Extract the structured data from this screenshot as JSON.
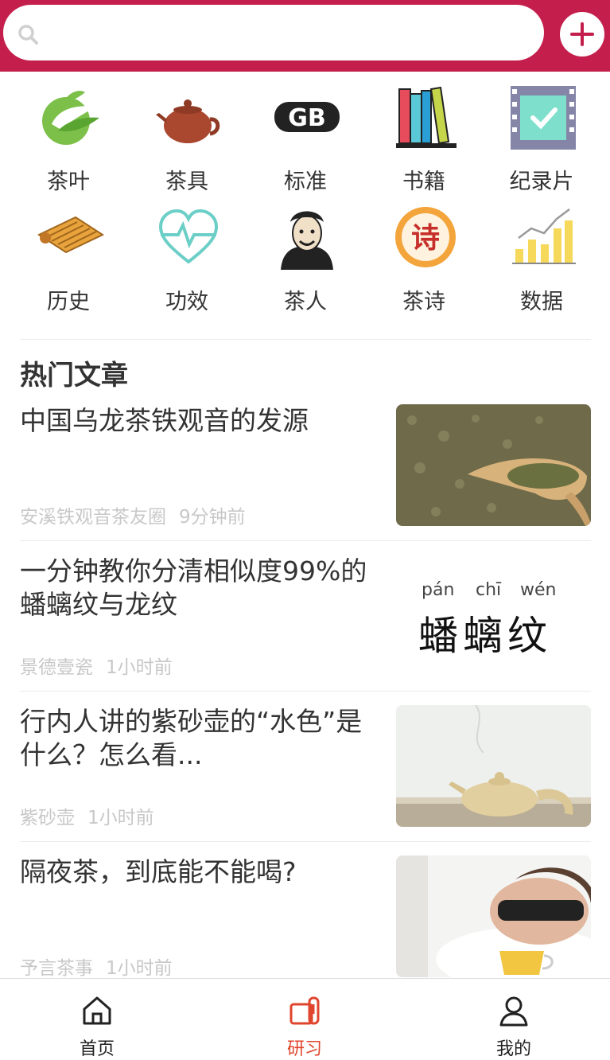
{
  "search": {
    "placeholder": ""
  },
  "categories": [
    {
      "label": "茶叶",
      "icon": "tea-leaf-icon"
    },
    {
      "label": "茶具",
      "icon": "teapot-icon"
    },
    {
      "label": "标准",
      "icon": "gb-standard-icon"
    },
    {
      "label": "书籍",
      "icon": "books-icon"
    },
    {
      "label": "纪录片",
      "icon": "film-icon"
    },
    {
      "label": "历史",
      "icon": "scroll-icon"
    },
    {
      "label": "功效",
      "icon": "heart-pulse-icon"
    },
    {
      "label": "茶人",
      "icon": "portrait-icon"
    },
    {
      "label": "茶诗",
      "icon": "poem-seal-icon"
    },
    {
      "label": "数据",
      "icon": "bar-chart-icon"
    }
  ],
  "section": {
    "title": "热门文章"
  },
  "articles": [
    {
      "title": "中国乌龙茶铁观音的发源",
      "source": "安溪铁观音茶友圈",
      "time": "9分钟前",
      "thumb": "tea-leaves-scoop-photo"
    },
    {
      "title": "一分钟教你分清相似度99%的蟠螭纹与龙纹",
      "source": "景德壹瓷",
      "time": "1小时前",
      "thumb": "panchiwen-calligraphy-image",
      "thumb_text": {
        "pinyin1": "pán",
        "pinyin2": "chī",
        "pinyin3": "wén",
        "chars": "蟠螭纹"
      }
    },
    {
      "title": "行内人讲的紫砂壶的“水色”是什么？怎么看...",
      "source": "紫砂壶",
      "time": "1小时前",
      "thumb": "zisha-teapot-photo"
    },
    {
      "title": "隔夜茶，到底能不能喝?",
      "source": "予言茶事",
      "time": "1小时前",
      "thumb": "sleeping-man-tea-photo"
    }
  ],
  "tabbar": {
    "tabs": [
      {
        "label": "首页",
        "icon": "home-icon",
        "active": false
      },
      {
        "label": "研习",
        "icon": "study-icon",
        "active": true
      },
      {
        "label": "我的",
        "icon": "user-icon",
        "active": false
      }
    ],
    "active_color": "#e0452d"
  },
  "colors": {
    "brand": "#c41f4c"
  }
}
